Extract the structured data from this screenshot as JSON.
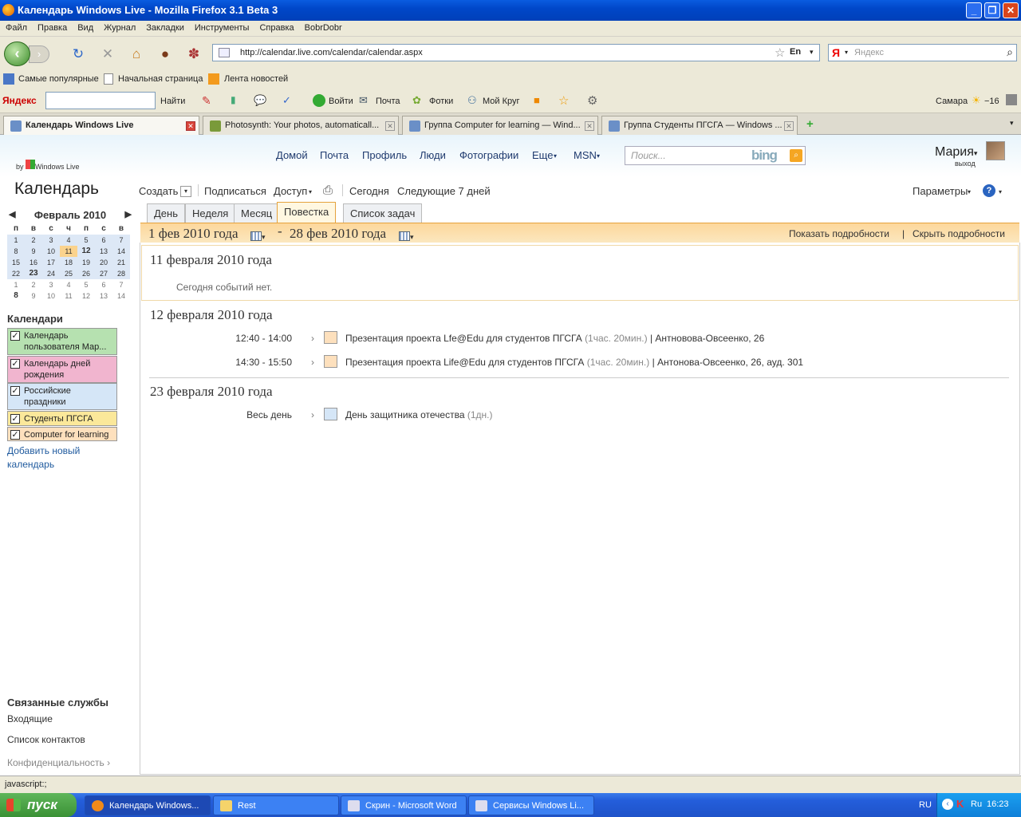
{
  "window": {
    "title": "Календарь Windows Live - Mozilla Firefox 3.1 Beta 3"
  },
  "menu": [
    "Файл",
    "Правка",
    "Вид",
    "Журнал",
    "Закладки",
    "Инструменты",
    "Справка",
    "BobrDobr"
  ],
  "nav": {
    "url": "http://calendar.live.com/calendar/calendar.aspx",
    "search_placeholder": "Яндекс",
    "lang": "En"
  },
  "bookmarks": [
    "Самые популярные",
    "Начальная страница",
    "Лента новостей"
  ],
  "yandex_bar": {
    "brand": "Яндекс",
    "find": "Найти",
    "login": "Войти",
    "mail": "Почта",
    "photos": "Фотки",
    "circle": "Мой Круг",
    "city": "Самара",
    "temp": "−16"
  },
  "tabs": [
    {
      "label": "Календарь Windows Live",
      "active": true
    },
    {
      "label": "Photosynth: Your photos, automaticall...",
      "active": false
    },
    {
      "label": "Группа Computer for learning — Wind...",
      "active": false
    },
    {
      "label": "Группа Студенты ПГСГА — Windows ...",
      "active": false
    }
  ],
  "header": {
    "by": "by",
    "brand": "Windows Live",
    "links": [
      "Домой",
      "Почта",
      "Профиль",
      "Люди",
      "Фотографии",
      "Еще",
      "MSN"
    ],
    "search_placeholder": "Поиск...",
    "bing": "bing",
    "user": "Мария",
    "logout": "выход"
  },
  "page_title": "Календарь",
  "commands": [
    "Создать",
    "Подписаться",
    "Доступ",
    "Сегодня",
    "Следующие 7 дней"
  ],
  "params": "Параметры",
  "mini_calendar": {
    "month": "Февраль 2010",
    "weekdays": [
      "п",
      "в",
      "с",
      "ч",
      "п",
      "с",
      "в"
    ],
    "weeks": [
      [
        "1",
        "2",
        "3",
        "4",
        "5",
        "6",
        "7"
      ],
      [
        "8",
        "9",
        "10",
        "11",
        "12",
        "13",
        "14"
      ],
      [
        "15",
        "16",
        "17",
        "18",
        "19",
        "20",
        "21"
      ],
      [
        "22",
        "23",
        "24",
        "25",
        "26",
        "27",
        "28"
      ],
      [
        "1",
        "2",
        "3",
        "4",
        "5",
        "6",
        "7"
      ],
      [
        "8",
        "9",
        "10",
        "11",
        "12",
        "13",
        "14"
      ]
    ]
  },
  "calendars_title": "Календари",
  "calendars": [
    {
      "label": "Календарь пользователя Мар...",
      "color": "#b6e1b0"
    },
    {
      "label": "Календарь дней рождения",
      "color": "#f1b5cf"
    },
    {
      "label": "Российские праздники",
      "color": "#d5e6f7"
    },
    {
      "label": "Студенты ПГСГА",
      "color": "#fbe89a"
    },
    {
      "label": "Computer for learning",
      "color": "#fde0bd"
    }
  ],
  "add_calendar": "Добавить новый календарь",
  "related": {
    "title": "Связанные службы",
    "items": [
      "Входящие",
      "Список контактов"
    ],
    "privacy": "Конфиденциальность"
  },
  "view_tabs": [
    "День",
    "Неделя",
    "Месяц",
    "Повестка",
    "Список задач"
  ],
  "range": {
    "from": "1 фев 2010 года",
    "to": "28 фев 2010 года",
    "dash": "-",
    "show": "Показать подробности",
    "sep": "|",
    "hide": "Скрыть подробности"
  },
  "agenda": {
    "day1": {
      "title": "11 февраля 2010 года",
      "empty": "Сегодня событий нет."
    },
    "day2": {
      "title": "12 февраля 2010 года",
      "events": [
        {
          "time": "12:40 - 14:00",
          "title": "Презентация проекта Lfe@Edu для студентов ПГСГА",
          "dur": "(1час. 20мин.)",
          "loc": "| Антновова-Овсеенко, 26"
        },
        {
          "time": "14:30 - 15:50",
          "title": "Презентация проекта Life@Edu для студентов ПГСГА",
          "dur": "(1час. 20мин.)",
          "loc": "| Антонова-Овсеенко, 26, ауд. 301"
        }
      ]
    },
    "day3": {
      "title": "23 февраля 2010 года",
      "events": [
        {
          "time": "Весь день",
          "title": "День защитника отечества",
          "dur": "(1дн.)"
        }
      ]
    }
  },
  "status": "javascript:;",
  "taskbar": {
    "start": "пуск",
    "tasks": [
      "Календарь Windows...",
      "Rest",
      "Скрин - Microsoft Word",
      "Сервисы Windows Li..."
    ],
    "lang": "RU",
    "lang2": "Ru",
    "clock": "16:23"
  }
}
